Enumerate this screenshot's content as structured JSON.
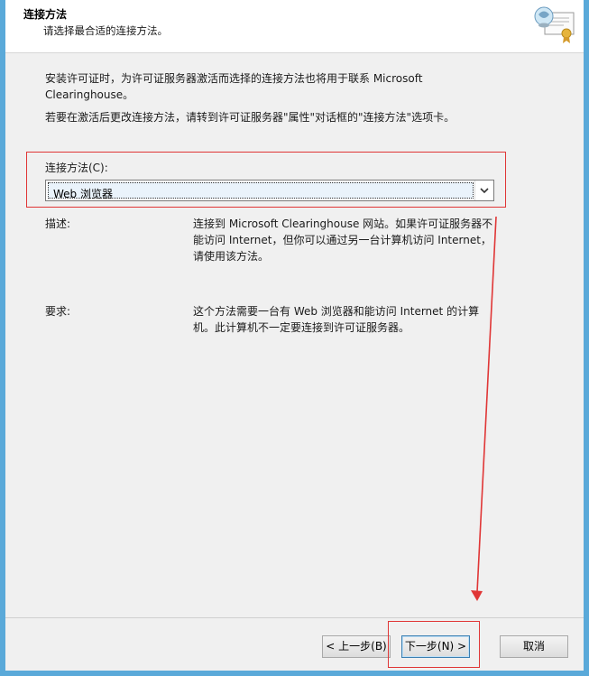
{
  "header": {
    "title": "连接方法",
    "subtitle": "请选择最合适的连接方法。",
    "icon": "certificate-icon"
  },
  "intro": {
    "paragraph1": "安装许可证时，为许可证服务器激活而选择的连接方法也将用于联系 Microsoft Clearinghouse。",
    "paragraph2": "若要在激活后更改连接方法，请转到许可证服务器\"属性\"对话框的\"连接方法\"选项卡。"
  },
  "connection_method": {
    "label": "连接方法(C):",
    "selected": "Web 浏览器"
  },
  "details": {
    "description_label": "描述:",
    "description_value": "连接到 Microsoft Clearinghouse 网站。如果许可证服务器不能访问 Internet，但你可以通过另一台计算机访问 Internet，请使用该方法。",
    "requirement_label": "要求:",
    "requirement_value": "这个方法需要一台有 Web 浏览器和能访问 Internet 的计算机。此计算机不一定要连接到许可证服务器。"
  },
  "footer": {
    "back_label": "< 上一步(B)",
    "next_label": "下一步(N) >",
    "cancel_label": "取消"
  },
  "colors": {
    "highlight": "#e03636",
    "background": "#f0f0f0",
    "header_background": "#ffffff"
  }
}
